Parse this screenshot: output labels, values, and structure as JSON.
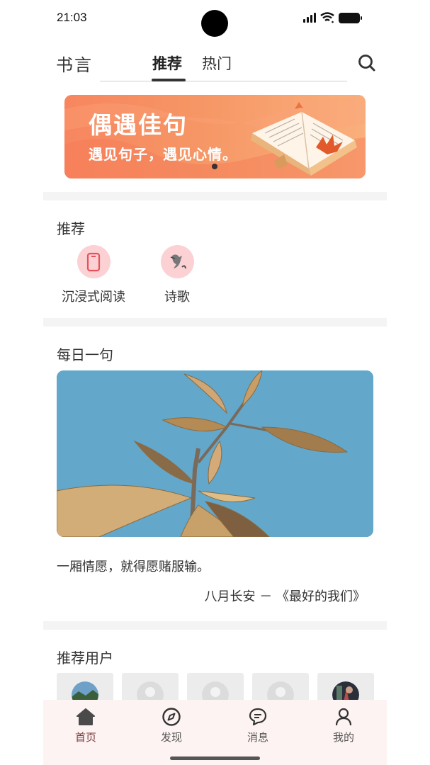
{
  "status_bar": {
    "time": "21:03"
  },
  "header": {
    "logo": "书言",
    "tabs": [
      {
        "label": "推荐",
        "active": true
      },
      {
        "label": "热门",
        "active": false
      }
    ],
    "search_icon": "search-icon"
  },
  "banner": {
    "title": "偶遇佳句",
    "subtitle": "遇见句子，遇见心情。",
    "colors": {
      "start": "#f7865f",
      "end": "#f9b07c"
    },
    "active_slide": 1,
    "slide_count": 1
  },
  "recommend": {
    "title": "推荐",
    "items": [
      {
        "label": "沉浸式阅读",
        "icon": "phone-icon"
      },
      {
        "label": "诗歌",
        "icon": "poetry-icon"
      }
    ]
  },
  "daily": {
    "title": "每日一句",
    "image": "leaves-photo",
    "quote": "一厢情愿，就得愿赌服输。",
    "source": "八月长安 － 《最好的我们》"
  },
  "users": {
    "title": "推荐用户",
    "cards": [
      {
        "avatar": "landscape-avatar"
      },
      {
        "avatar": "default-avatar"
      },
      {
        "avatar": "default-avatar"
      },
      {
        "avatar": "default-avatar"
      },
      {
        "avatar": "portrait-avatar"
      }
    ]
  },
  "bottom_nav": {
    "items": [
      {
        "label": "首页",
        "icon": "home-icon",
        "active": true
      },
      {
        "label": "发现",
        "icon": "compass-icon",
        "active": false
      },
      {
        "label": "消息",
        "icon": "message-icon",
        "active": false
      },
      {
        "label": "我的",
        "icon": "user-icon",
        "active": false
      }
    ]
  },
  "colors": {
    "accent": "#7a3b3b",
    "badge_bg": "#fbd1d4",
    "nav_bg": "#fdf3f2"
  }
}
